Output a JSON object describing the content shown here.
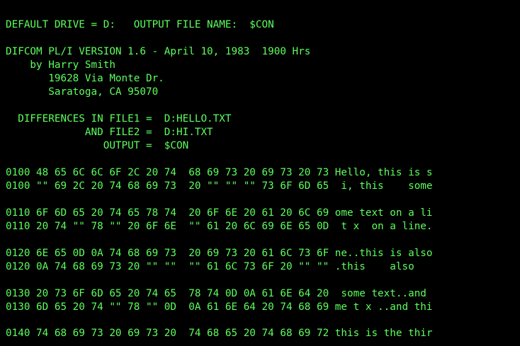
{
  "terminal": {
    "text_color": "#5cff5c",
    "background_color": "#000000",
    "header": {
      "default_drive_line": "DEFAULT DRIVE = D:   OUTPUT FILE NAME:  $CON"
    },
    "banner": {
      "title": "DIFCOM PL/I VERSION 1.6 - April 10, 1983  1900 Hrs",
      "author": "    by Harry Smith",
      "address_street": "       19628 Via Monte Dr.",
      "address_city": "       Saratoga, CA 95070"
    },
    "files": {
      "file1": "  DIFFERENCES IN FILE1 =  D:HELLO.TXT",
      "file2": "             AND FILE2 =  D:HI.TXT",
      "output": "                OUTPUT =  $CON"
    },
    "dump_rows": [
      "0100 48 65 6C 6C 6F 2C 20 74  68 69 73 20 69 73 20 73 Hello, this is s",
      "0100 \"\" 69 2C 20 74 68 69 73  20 \"\" \"\" \"\" 73 6F 6D 65  i, this    some",
      "0110 6F 6D 65 20 74 65 78 74  20 6F 6E 20 61 20 6C 69 ome text on a li",
      "0110 20 74 \"\" 78 \"\" 20 6F 6E  \"\" 61 20 6C 69 6E 65 0D  t x  on a line.",
      "0120 6E 65 0D 0A 74 68 69 73  20 69 73 20 61 6C 73 6F ne..this is also",
      "0120 0A 74 68 69 73 20 \"\" \"\"  \"\" 61 6C 73 6F 20 \"\" \"\" .this    also",
      "0130 20 73 6F 6D 65 20 74 65  78 74 0D 0A 61 6E 64 20  some text..and",
      "0130 6D 65 20 74 \"\" 78 \"\" 0D  0A 61 6E 64 20 74 68 69 me t x ..and thi",
      "0140 74 68 69 73 20 69 73 20  74 68 65 20 74 68 69 72 this is the thir"
    ]
  }
}
